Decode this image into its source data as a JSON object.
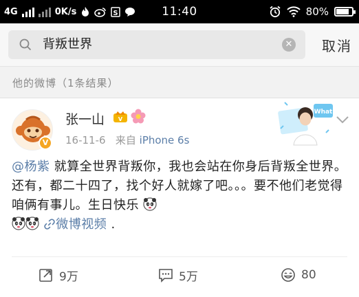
{
  "status_bar": {
    "network": "4G",
    "speed": "0K/s",
    "time": "11:40",
    "battery": "80%",
    "battery_level": 0.8,
    "icons": [
      "signal-icon",
      "signal-2-icon",
      "fire-icon",
      "weibo-icon",
      "s-icon",
      "chat-icon",
      "alarm-icon",
      "wifi-icon",
      "battery-icon"
    ]
  },
  "search": {
    "query": "背叛世界",
    "cancel_label": "取消"
  },
  "result_header": {
    "label": "他的微博（1条结果）"
  },
  "post": {
    "username": "张一山",
    "date": "16-11-6",
    "source_prefix": "来自",
    "source": "iPhone 6s",
    "mention": "@杨紫",
    "body": " 就算全世界背叛你，我也会站在你身后背叛全世界。还有，都二十四了，找个好人就嫁了吧。。。要不他们老觉得咱俩有事儿。生日快乐",
    "link_text": "微博视频",
    "tail": " .",
    "reposts": "9万",
    "comments": "5万",
    "likes": "80"
  },
  "colors": {
    "accent_link": "#5b7ea8",
    "verified_badge": "#f5a623",
    "status_bar_bg": "#000000"
  }
}
